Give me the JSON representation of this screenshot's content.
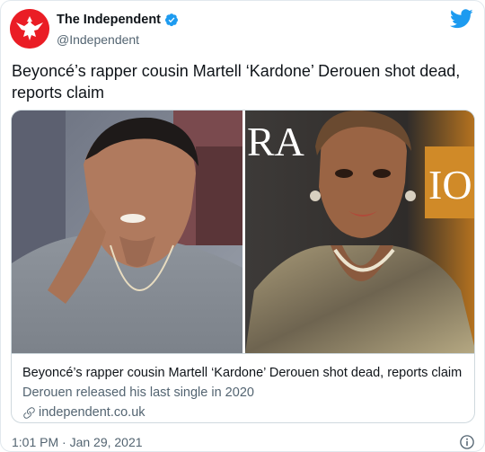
{
  "author": {
    "name": "The Independent",
    "handle": "@Independent"
  },
  "tweet": {
    "text": "Beyoncé’s rapper cousin Martell ‘Kardone’ Derouen shot dead, reports claim",
    "timestamp": "1:01 PM · Jan 29, 2021"
  },
  "card": {
    "title": "Beyoncé’s rapper cousin Martell ‘Kardone’ Derouen shot dead, reports claim",
    "description": "Derouen released his last single in 2020",
    "domain": "independent.co.uk",
    "right_photo_sign_left": "RA",
    "right_photo_sign_right": "IO"
  },
  "colors": {
    "twitter_blue": "#1d9bf0",
    "independent_red": "#ea1d25",
    "secondary_text": "#536471"
  },
  "icons": {
    "avatar": "independent-eagle-logo",
    "verified": "verified-badge-icon",
    "brand": "twitter-bird-icon",
    "link": "link-icon",
    "info": "info-icon"
  }
}
